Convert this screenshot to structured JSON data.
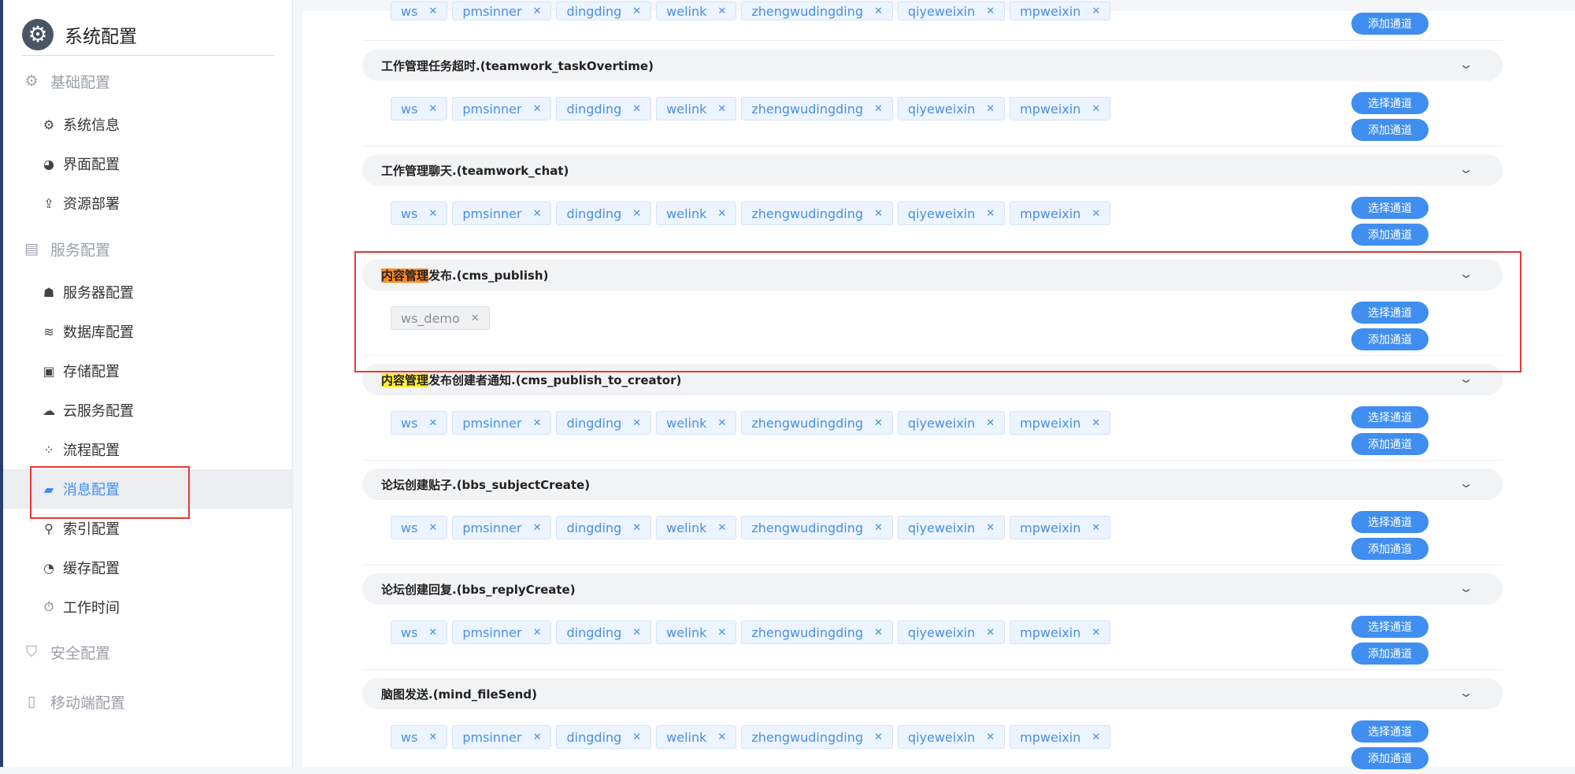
{
  "sidebar": {
    "title": "系统配置",
    "groups": {
      "basic": "基础配置",
      "service": "服务配置",
      "security": "安全配置",
      "mobile": "移动端配置"
    },
    "items": {
      "sysinfo": "系统信息",
      "ui": "界面配置",
      "resource": "资源部署",
      "server": "服务器配置",
      "database": "数据库配置",
      "storage": "存储配置",
      "cloud": "云服务配置",
      "flow": "流程配置",
      "message": "消息配置",
      "index": "索引配置",
      "cache": "缓存配置",
      "worktime": "工作时间"
    }
  },
  "buttons": {
    "select": "选择通道",
    "add": "添加通道"
  },
  "channels": [
    "ws",
    "pmsinner",
    "dingding",
    "welink",
    "zhengwudingding",
    "qiyeweixin",
    "mpweixin"
  ],
  "sections": {
    "s1": {
      "title": "工作管理任务超时.(teamwork_taskOvertime)"
    },
    "s2": {
      "title": "工作管理聊天.(teamwork_chat)"
    },
    "s3": {
      "highlight": "内容管理",
      "rest": "发布.(cms_publish)",
      "channels": [
        "ws_demo"
      ]
    },
    "s4": {
      "highlight": "内容管理",
      "rest": "发布创建者通知.(cms_publish_to_creator)"
    },
    "s5": {
      "title": "论坛创建贴子.(bbs_subjectCreate)"
    },
    "s6": {
      "title": "论坛创建回复.(bbs_replyCreate)"
    },
    "s7": {
      "title": "脑图发送.(mind_fileSend)"
    }
  },
  "colors": {
    "accent": "#3f8ef0",
    "highlight_box": "#e53935",
    "search_highlight": "#ffee33",
    "current_highlight": "#ff8a1e"
  },
  "icons": [
    "gear-icon",
    "palette-icon",
    "deploy-icon",
    "server-icon",
    "database-icon",
    "storage-icon",
    "cloud-icon",
    "flow-icon",
    "message-icon",
    "search-icon",
    "pie-icon",
    "stopwatch-icon",
    "shield-icon",
    "mobile-icon",
    "chevron-down-icon",
    "close-icon"
  ]
}
